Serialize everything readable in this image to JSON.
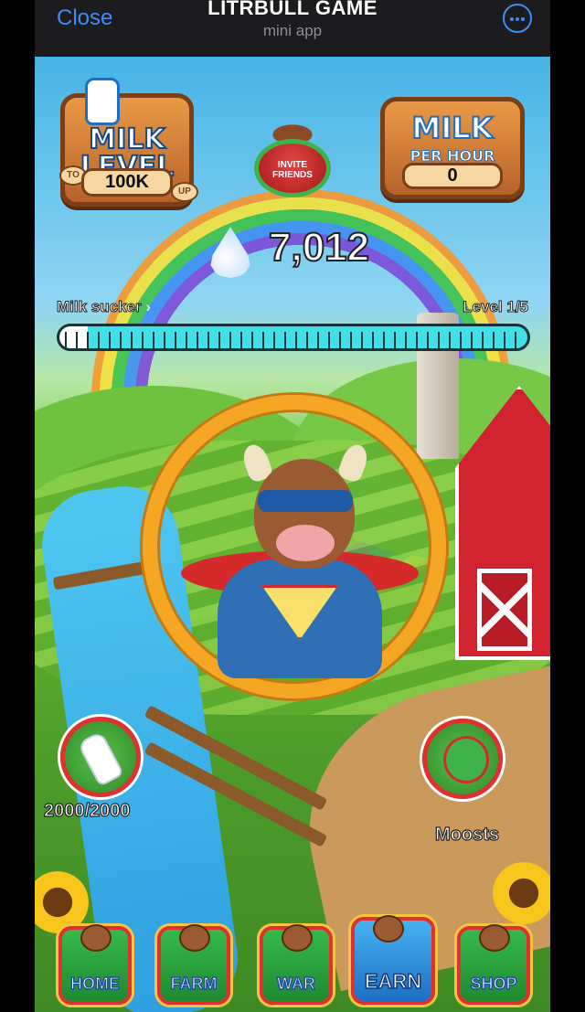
{
  "header": {
    "close_label": "Close",
    "title": "LITRBULL GAME",
    "subtitle": "mini app",
    "more_icon": "more-horizontal-icon"
  },
  "hud": {
    "milk_level": {
      "line1": "MILK",
      "line2": "LEVEL",
      "value": "100K",
      "tag_left": "TO",
      "tag_right": "UP"
    },
    "invite": {
      "label_line1": "INVITE",
      "label_line2": "FRIENDS"
    },
    "milk_per_hour": {
      "line1": "MILK",
      "line2": "PER HOUR",
      "value": "0"
    },
    "balance": "7,012",
    "rank": "Milk sucker",
    "rank_chevron": "›",
    "level": "Level 1/5",
    "progress_fraction": 0.06
  },
  "side": {
    "energy": "2000/2000",
    "moosts": "Moosts"
  },
  "nav": [
    {
      "label": "HOME"
    },
    {
      "label": "FARM"
    },
    {
      "label": "WAR"
    },
    {
      "label": "EARN"
    },
    {
      "label": "SHOP"
    }
  ],
  "colors": {
    "accent": "#3e8ef7",
    "ring": "#f5a623",
    "progress": "#3fe0e6",
    "nav_green": "#36b84b",
    "nav_border": "#e03030"
  }
}
